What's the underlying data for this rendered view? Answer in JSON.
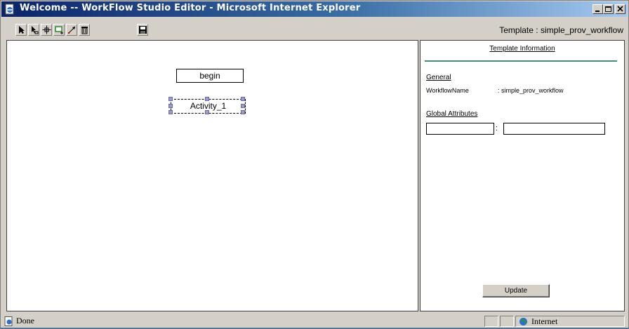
{
  "window": {
    "title": "Welcome -- WorkFlow Studio Editor - Microsoft Internet Explorer",
    "icon": "ie-page-icon",
    "controls": [
      "minimize-icon",
      "maximize-icon",
      "close-icon"
    ]
  },
  "toolbar": {
    "tools": [
      "select-arrow-icon",
      "select-node-icon",
      "move-icon",
      "add-activity-icon",
      "connect-icon",
      "delete-icon",
      "save-icon"
    ],
    "template_label": "Template : simple_prov_workflow"
  },
  "canvas": {
    "nodes": [
      {
        "label": "begin",
        "selected": false
      },
      {
        "label": "Activity_1",
        "selected": true
      }
    ]
  },
  "panel": {
    "title": "Template Information",
    "general_label": "General",
    "workflow_name_key": "WorkflowName",
    "workflow_name_value": ": simple_prov_workflow",
    "global_attributes_label": "Global Attributes",
    "attr_key_value": "",
    "attr_separator": ":",
    "attr_value_value": "",
    "update_label": "Update",
    "accent_color": "#4a8a72"
  },
  "statusbar": {
    "status_text": "Done",
    "zone_text": "Internet"
  }
}
